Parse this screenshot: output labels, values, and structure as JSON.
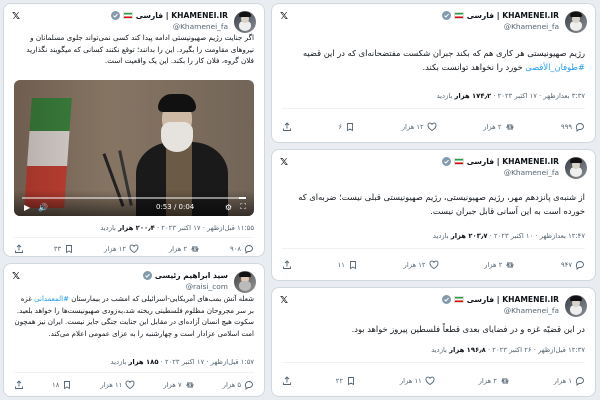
{
  "colors": {
    "link": "#1d9bf0",
    "muted": "#536471",
    "border": "#cfd9de"
  },
  "khamenei": {
    "name": "KHAMENEI.IR | فارسی",
    "handle": "@Khamenei_fa"
  },
  "raisi": {
    "name": "سید ابراهیم رئیسی",
    "handle": "@raisi_com"
  },
  "tweets": {
    "t1": {
      "body1": "رژیم صهیونیستی هر کاری هم که بکند جبران شکست مفتضحانه‌ای که در این قضیه",
      "hashtag": "#طوفان_الأقصی",
      "body2": " خورد را نخواهد توانست بکند.",
      "views": "۱۷۴٫۲ هزار",
      "views_label": " بازدید",
      "date": "۳:۳۷ بعدازظهر · ۱۷ اکتبر ۲۰۲۳ · ",
      "reply": "۹۹۹",
      "retweet": "۲ هزار",
      "like": "۱۲ هزار",
      "bookmark": "۶"
    },
    "t2": {
      "body": "از شنبه‌ی پانزدهم مهر، رژیم صهیونیستی، رژیم صهیونیستی قبلی نیست؛ ضربه‌ای که خورده است به این آسانی قابل جبران نیست.",
      "views": "۲۰۳٫۷ هزار",
      "views_label": " بازدید",
      "date": "۱۲:۴۷ بعدازظهر · ۱۰ اکتبر ۲۰۲۳ · ",
      "reply": "۹۴۷",
      "retweet": "۲ هزار",
      "like": "۱۲ هزار",
      "bookmark": "۱۱"
    },
    "t3": {
      "body": "در این قضیّه غزه و در فضایای بعدی قطعاً فلسطین پیروز خواهد بود.",
      "views": "۱۹۶٫۸ هزار",
      "views_label": " بازدید",
      "date": "۱۲:۳۷ قبل‌ازظهر · ۲۶ اکتبر ۲۰۲۳ · ",
      "reply": "۱ هزار",
      "retweet": "۲ هزار",
      "like": "۱۱ هزار",
      "bookmark": "۲۲"
    },
    "t4": {
      "body": "اگر جنایت رژیم صهیونیستی ادامه پیدا کند کسی نمی‌تواند جلوی مسلمانان و نیروهای مقاومت را بگیرد. این را بدانند؛ توقع نکنند کسانی که میگویند نگذارید فلان گروه، فلان کار را بکند. این یک واقعیت است.",
      "video_time": "0:53 / 0:04",
      "views": "۲۰۰٫۴ هزار",
      "views_label": " بازدید",
      "date": "۱۱:۵۵ قبل‌ازظهر · ۱۷ اکتبر ۲۰۲۳ · ",
      "reply": "۹۰۸",
      "retweet": "۲ هزار",
      "like": "۱۲ هزار",
      "bookmark": "۳۳"
    },
    "t5": {
      "body1": "شعله آتش بمب‌های آمریکایی-اسرائیلی که امشب در بیمارستان ",
      "hashtag": "#المعمدانی",
      "body2": " غزه بر سر مجروحان مظلوم فلسطینی ریخته شد،به‌زودی صهیونیست‌ها را خواهد بلعید. سکوت هیچ انسان آزاده‌ای در مقابل این جنایت جنگی جایز نیست. ایران نیز همچون امت اسلامی عزادار است و چهارشنبه را به عزای عمومی اعلام می‌کند.",
      "views": "۱۸۵ هزار",
      "views_label": " بازدید",
      "date": "۱:۵۷ قبل‌ازظهر · ۱۷ اکتبر ۲۰۲۳ · ",
      "reply": "۵ هزار",
      "retweet": "۷ هزار",
      "like": "۱۱ هزار",
      "bookmark": "۱۸"
    }
  }
}
